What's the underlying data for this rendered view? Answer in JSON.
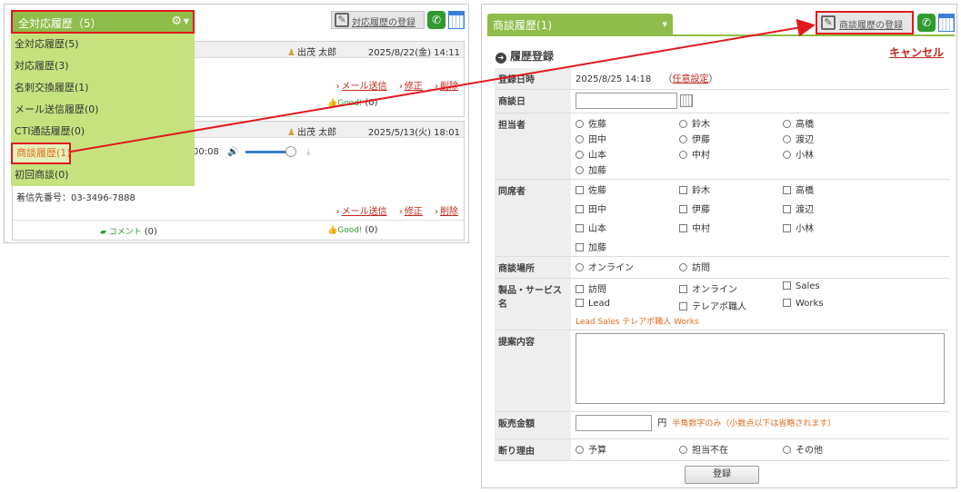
{
  "left": {
    "dropdown_title": "全対応履歴（5）",
    "gear_icon": "gear-icon",
    "menu": [
      "全対応履歴(5)",
      "対応履歴(3)",
      "名刺交換履歴(1)",
      "メール送信履歴(0)",
      "CTI通話履歴(0)",
      "商談履歴(1)",
      "初回商談(0)"
    ],
    "register_label": "対応履歴の登録",
    "card1": {
      "user": "出茂 太郎",
      "date": "2025/8/22(金) 14:11",
      "good_count": "(0)"
    },
    "card2": {
      "user": "出茂 太郎",
      "date": "2025/5/13(火) 18:01",
      "audio_time": "00:08",
      "callee": "着信先番号：03-3496-7888",
      "comment_label": "コメント",
      "comment_count": "(0)",
      "good_count": "(0)"
    },
    "links": {
      "mail": "メール送信",
      "edit": "修正",
      "delete": "削除"
    },
    "good_label": "Good!"
  },
  "right": {
    "tab_title": "商談履歴(1)",
    "register_label": "商談履歴の登録",
    "section_title": "履歴登録",
    "cancel_label": "キャンセル",
    "fields": {
      "reg_datetime": {
        "label": "登録日時",
        "value": "2025/8/25 14:18",
        "setting": "任意設定"
      },
      "meeting_date": {
        "label": "商談日"
      },
      "owner": {
        "label": "担当者",
        "options": [
          "佐藤",
          "鈴木",
          "高橋",
          "田中",
          "伊藤",
          "渡辺",
          "山本",
          "中村",
          "小林",
          "加藤"
        ]
      },
      "attendee": {
        "label": "同席者",
        "options": [
          "佐藤",
          "鈴木",
          "高橋",
          "田中",
          "伊藤",
          "渡辺",
          "山本",
          "中村",
          "小林",
          "加藤"
        ]
      },
      "place": {
        "label": "商談場所",
        "options": [
          "オンライン",
          "訪問"
        ]
      },
      "product": {
        "label": "製品・サービス名",
        "options": [
          "訪問",
          "オンライン",
          "Sales",
          "Lead",
          "テレアポ職人",
          "Works"
        ],
        "note": "Lead Sales テレアポ職人 Works"
      },
      "proposal": {
        "label": "提案内容"
      },
      "amount": {
        "label": "販売金額",
        "unit": "円",
        "note": "半角数字のみ（小数点以下は省略されます）"
      },
      "reason": {
        "label": "断り理由",
        "options": [
          "予算",
          "担当不在",
          "その他"
        ]
      }
    },
    "submit_label": "登録"
  },
  "colors": {
    "accent_green": "#8fbc4a",
    "highlight_red": "#e0191d",
    "link_red": "#c0281c",
    "note_orange": "#e26a1c"
  }
}
